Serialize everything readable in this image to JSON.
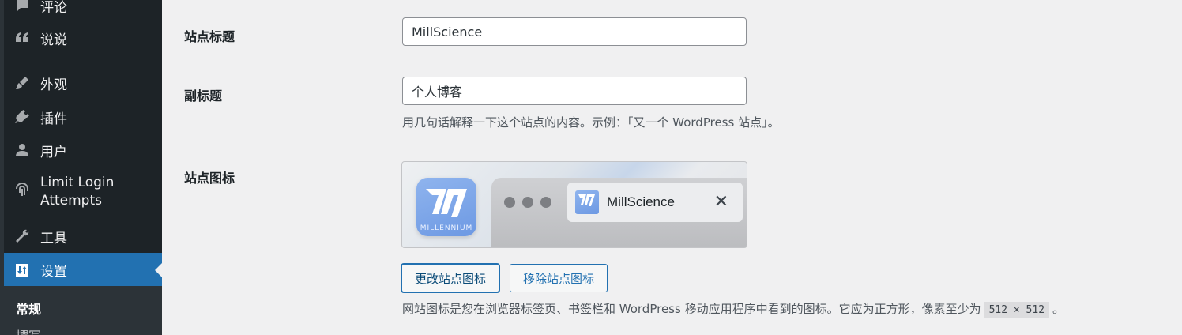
{
  "sidebar": {
    "items": [
      {
        "label": "评论",
        "icon": "comment-icon"
      },
      {
        "label": "说说",
        "icon": "quote-icon"
      },
      {
        "label": "外观",
        "icon": "brush-icon"
      },
      {
        "label": "插件",
        "icon": "plugin-icon"
      },
      {
        "label": "用户",
        "icon": "user-icon"
      },
      {
        "label": "Limit Login\nAttempts",
        "label_line1": "Limit Login",
        "label_line2": "Attempts",
        "icon": "fingerprint-icon"
      },
      {
        "label": "工具",
        "icon": "wrench-icon"
      },
      {
        "label": "设置",
        "icon": "settings-icon",
        "current": true
      }
    ],
    "submenu": [
      {
        "label": "常规",
        "current": true
      },
      {
        "label": "撰写"
      }
    ]
  },
  "form": {
    "site_title": {
      "label": "站点标题",
      "value": "MillScience"
    },
    "tagline": {
      "label": "副标题",
      "value": "个人博客",
      "description": "用几句话解释一下这个站点的内容。示例：「又一个 WordPress 站点」。"
    },
    "site_icon": {
      "label": "站点图标",
      "preview_title": "MillScience",
      "brand_text": "MILLENNIUM",
      "change_button": "更改站点图标",
      "remove_button": "移除站点图标",
      "description_prefix": "网站图标是您在浏览器标签页、书签栏和 WordPress 移动应用程序中看到的图标。它应为正方形，像素至少为",
      "size_code": "512 × 512",
      "description_suffix": "。"
    }
  },
  "colors": {
    "sidebar_bg": "#1d2327",
    "accent": "#2271b1",
    "page_bg": "#f0f0f1"
  }
}
